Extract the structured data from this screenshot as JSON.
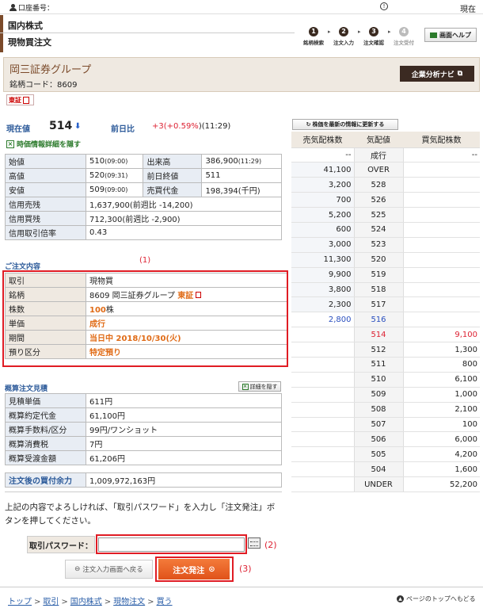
{
  "top": {
    "account_label": "口座番号：",
    "clock_glyph": "!",
    "now_label": "現在"
  },
  "header": {
    "category": "国内株式",
    "page_title": "現物買注文",
    "steps": [
      {
        "num": "1",
        "label": "銘柄検索"
      },
      {
        "num": "2",
        "label": "注文入力"
      },
      {
        "num": "3",
        "label": "注文確認"
      },
      {
        "num": "4",
        "label": "注文受付"
      }
    ],
    "help_label": "画面ヘルプ"
  },
  "company": {
    "name": "岡三証券グループ",
    "code_line": "銘柄コード：8609",
    "analysis_button": "企業分析ナビ",
    "exchange_badge": "東証"
  },
  "price": {
    "label": "現在値",
    "value": "514",
    "arrow": "⬇",
    "change_label": "前日比",
    "change_prefix": "+3(",
    "change_pct": "+0.59%",
    "change_suffix": ")(11:29)",
    "hide_link": "時価情報詳細を隠す"
  },
  "stock_table": {
    "open_label": "始値",
    "open_value": "510",
    "open_time": "(09:00)",
    "volume_label": "出来高",
    "volume_value": "386,900",
    "volume_time": "(11:29)",
    "high_label": "高値",
    "high_value": "520",
    "high_time": "(09:31)",
    "prev_close_label": "前日終値",
    "prev_close_value": "511",
    "low_label": "安値",
    "low_value": "509",
    "low_time": "(09:00)",
    "turnover_label": "売買代金",
    "turnover_value": "198,394(千円)",
    "margin_sell_label": "信用売残",
    "margin_sell_value": "1,637,900(前週比 -14,200)",
    "margin_buy_label": "信用買残",
    "margin_buy_value": "712,300(前週比 -2,900)",
    "margin_ratio_label": "信用取引倍率",
    "margin_ratio_value": "0.43"
  },
  "order": {
    "section_label": "ご注文内容",
    "annotation": "(1)",
    "rows": {
      "trade_label": "取引",
      "trade_value": "現物買",
      "stock_label": "銘柄",
      "stock_value": "8609 岡三証券グループ",
      "stock_exchange": "東証",
      "qty_label": "株数",
      "qty_value": "100",
      "qty_unit": "株",
      "price_label": "単価",
      "price_value": "成行",
      "period_label": "期間",
      "period_value": "当日中 2018/10/30(火)",
      "account_label": "預り区分",
      "account_value": "特定預り"
    }
  },
  "estimate": {
    "section_label": "概算注文見積",
    "detail_toggle": "詳細を隠す",
    "unit_price_label": "見積単価",
    "unit_price_value": "611円",
    "contract_label": "概算約定代金",
    "contract_value": "61,100円",
    "fee_label": "概算手数料/区分",
    "fee_value": "99円/ワンショット",
    "tax_label": "概算消費税",
    "tax_value": "7円",
    "total_label": "概算受渡金額",
    "total_value": "61,206円",
    "post_label": "注文後の買付余力",
    "post_value": "1,009,972,163円"
  },
  "confirm": {
    "instruction": "上記の内容でよろしければ、「取引パスワード」を入力し「注文発注」ボタンを押してください。",
    "password_label": "取引パスワード：",
    "password_value": "",
    "annotation_pw": "(2)",
    "back_button": "注文入力画面へ戻る",
    "order_button": "注文発注",
    "annotation_btn": "(3)"
  },
  "board": {
    "refresh_button": "株価を最新の情報に更新する",
    "headers": {
      "sell": "売気配株数",
      "price": "気配値",
      "buy": "買気配株数"
    },
    "rows": [
      {
        "sell": "--",
        "price": "成行",
        "buy": "--"
      },
      {
        "sell": "41,100",
        "price": "OVER",
        "buy": ""
      },
      {
        "sell": "3,200",
        "price": "528",
        "buy": ""
      },
      {
        "sell": "700",
        "price": "526",
        "buy": ""
      },
      {
        "sell": "5,200",
        "price": "525",
        "buy": ""
      },
      {
        "sell": "600",
        "price": "524",
        "buy": ""
      },
      {
        "sell": "3,000",
        "price": "523",
        "buy": ""
      },
      {
        "sell": "11,300",
        "price": "520",
        "buy": ""
      },
      {
        "sell": "9,900",
        "price": "519",
        "buy": ""
      },
      {
        "sell": "3,800",
        "price": "518",
        "buy": ""
      },
      {
        "sell": "2,300",
        "price": "517",
        "buy": ""
      },
      {
        "sell": "2,800",
        "price": "516",
        "buy": ""
      },
      {
        "sell": "",
        "price": "514",
        "buy": "9,100"
      },
      {
        "sell": "",
        "price": "512",
        "buy": "1,300"
      },
      {
        "sell": "",
        "price": "511",
        "buy": "800"
      },
      {
        "sell": "",
        "price": "510",
        "buy": "6,100"
      },
      {
        "sell": "",
        "price": "509",
        "buy": "1,000"
      },
      {
        "sell": "",
        "price": "508",
        "buy": "2,100"
      },
      {
        "sell": "",
        "price": "507",
        "buy": "100"
      },
      {
        "sell": "",
        "price": "506",
        "buy": "6,000"
      },
      {
        "sell": "",
        "price": "505",
        "buy": "4,200"
      },
      {
        "sell": "",
        "price": "504",
        "buy": "1,600"
      },
      {
        "sell": "",
        "price": "UNDER",
        "buy": "52,200"
      }
    ]
  },
  "footer": {
    "breadcrumb": [
      "トップ",
      "取引",
      "国内株式",
      "現物注文",
      "買う"
    ],
    "separator": ">",
    "page_top": "ページのトップへもどる"
  },
  "colors": {
    "accent_brown": "#7b4a2a",
    "link_blue": "#2a5ea8",
    "highlight_red": "#e01c24",
    "order_orange": "#e06b16"
  }
}
